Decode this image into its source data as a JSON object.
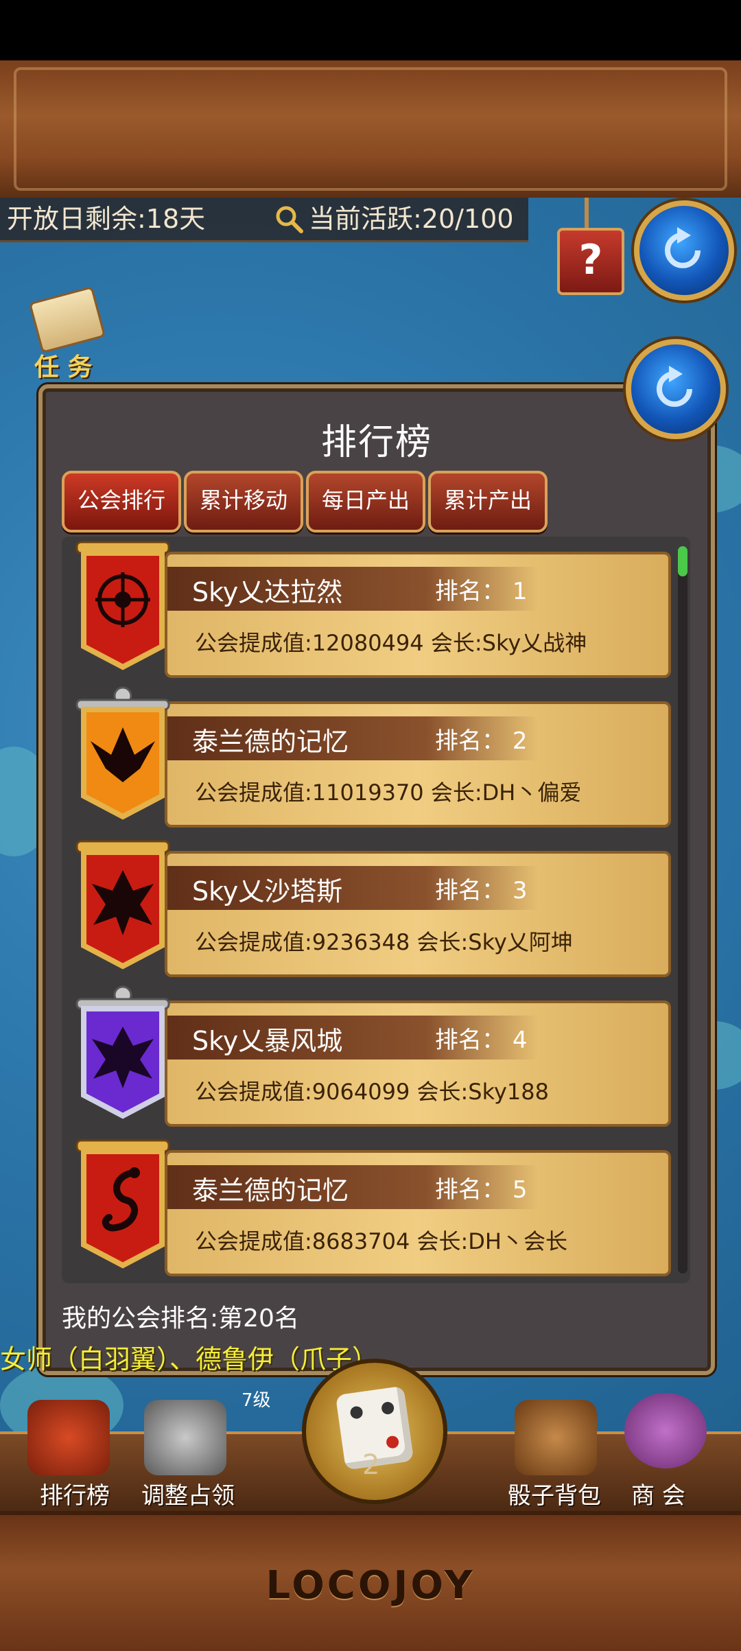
{
  "topbar": {
    "days_remaining": "开放日剩余:18天",
    "active_count": "当前活跃:20/100",
    "help_label": "?"
  },
  "quest": {
    "label": "任 务"
  },
  "panel": {
    "title": "排行榜",
    "tabs": [
      "公会排行",
      "累计移动",
      "每日产出",
      "累计产出"
    ],
    "selected_tab": "公会排行"
  },
  "ranking": [
    {
      "name": "Sky乂达拉然",
      "rank_label": "排名：",
      "rank": "1",
      "score_label": "公会提成值:12080494",
      "leader_label": "会长:Sky乂战神",
      "banner_color": "#c81c12",
      "emblem": "compass-emblem"
    },
    {
      "name": "泰兰德的记忆",
      "rank_label": "排名：",
      "rank": "2",
      "score_label": "公会提成值:11019370",
      "leader_label": "会长:DH丶偏爱",
      "banner_color": "#f08a12",
      "emblem": "phoenix-emblem"
    },
    {
      "name": "Sky乂沙塔斯",
      "rank_label": "排名：",
      "rank": "3",
      "score_label": "公会提成值:9236348",
      "leader_label": "会长:Sky乂阿坤",
      "banner_color": "#c81c12",
      "emblem": "dragon-emblem"
    },
    {
      "name": "Sky乂暴风城",
      "rank_label": "排名：",
      "rank": "4",
      "score_label": "公会提成值:9064099",
      "leader_label": "会长:Sky188",
      "banner_color": "#6a2ad0",
      "emblem": "dragon-emblem"
    },
    {
      "name": "泰兰德的记忆",
      "rank_label": "排名：",
      "rank": "5",
      "score_label": "公会提成值:8683704",
      "leader_label": "会长:DH丶会长",
      "banner_color": "#c81c12",
      "emblem": "serpent-emblem"
    }
  ],
  "my_rank": "我的公会排名:第20名",
  "marquee": "女师（白羽翼）、德鲁伊（爪子）",
  "bottom": {
    "level_text": "7级",
    "dice_count": "2",
    "labels": [
      "排行榜",
      "调整占领",
      "骰子背包",
      "商 会"
    ]
  },
  "logo": "LOCOJOY",
  "colors": {
    "accent_gold": "#d9a25a",
    "tab_red": "#b3462b",
    "card_gold": "#f0cd82",
    "marquee_yellow": "#f3ee3a"
  }
}
